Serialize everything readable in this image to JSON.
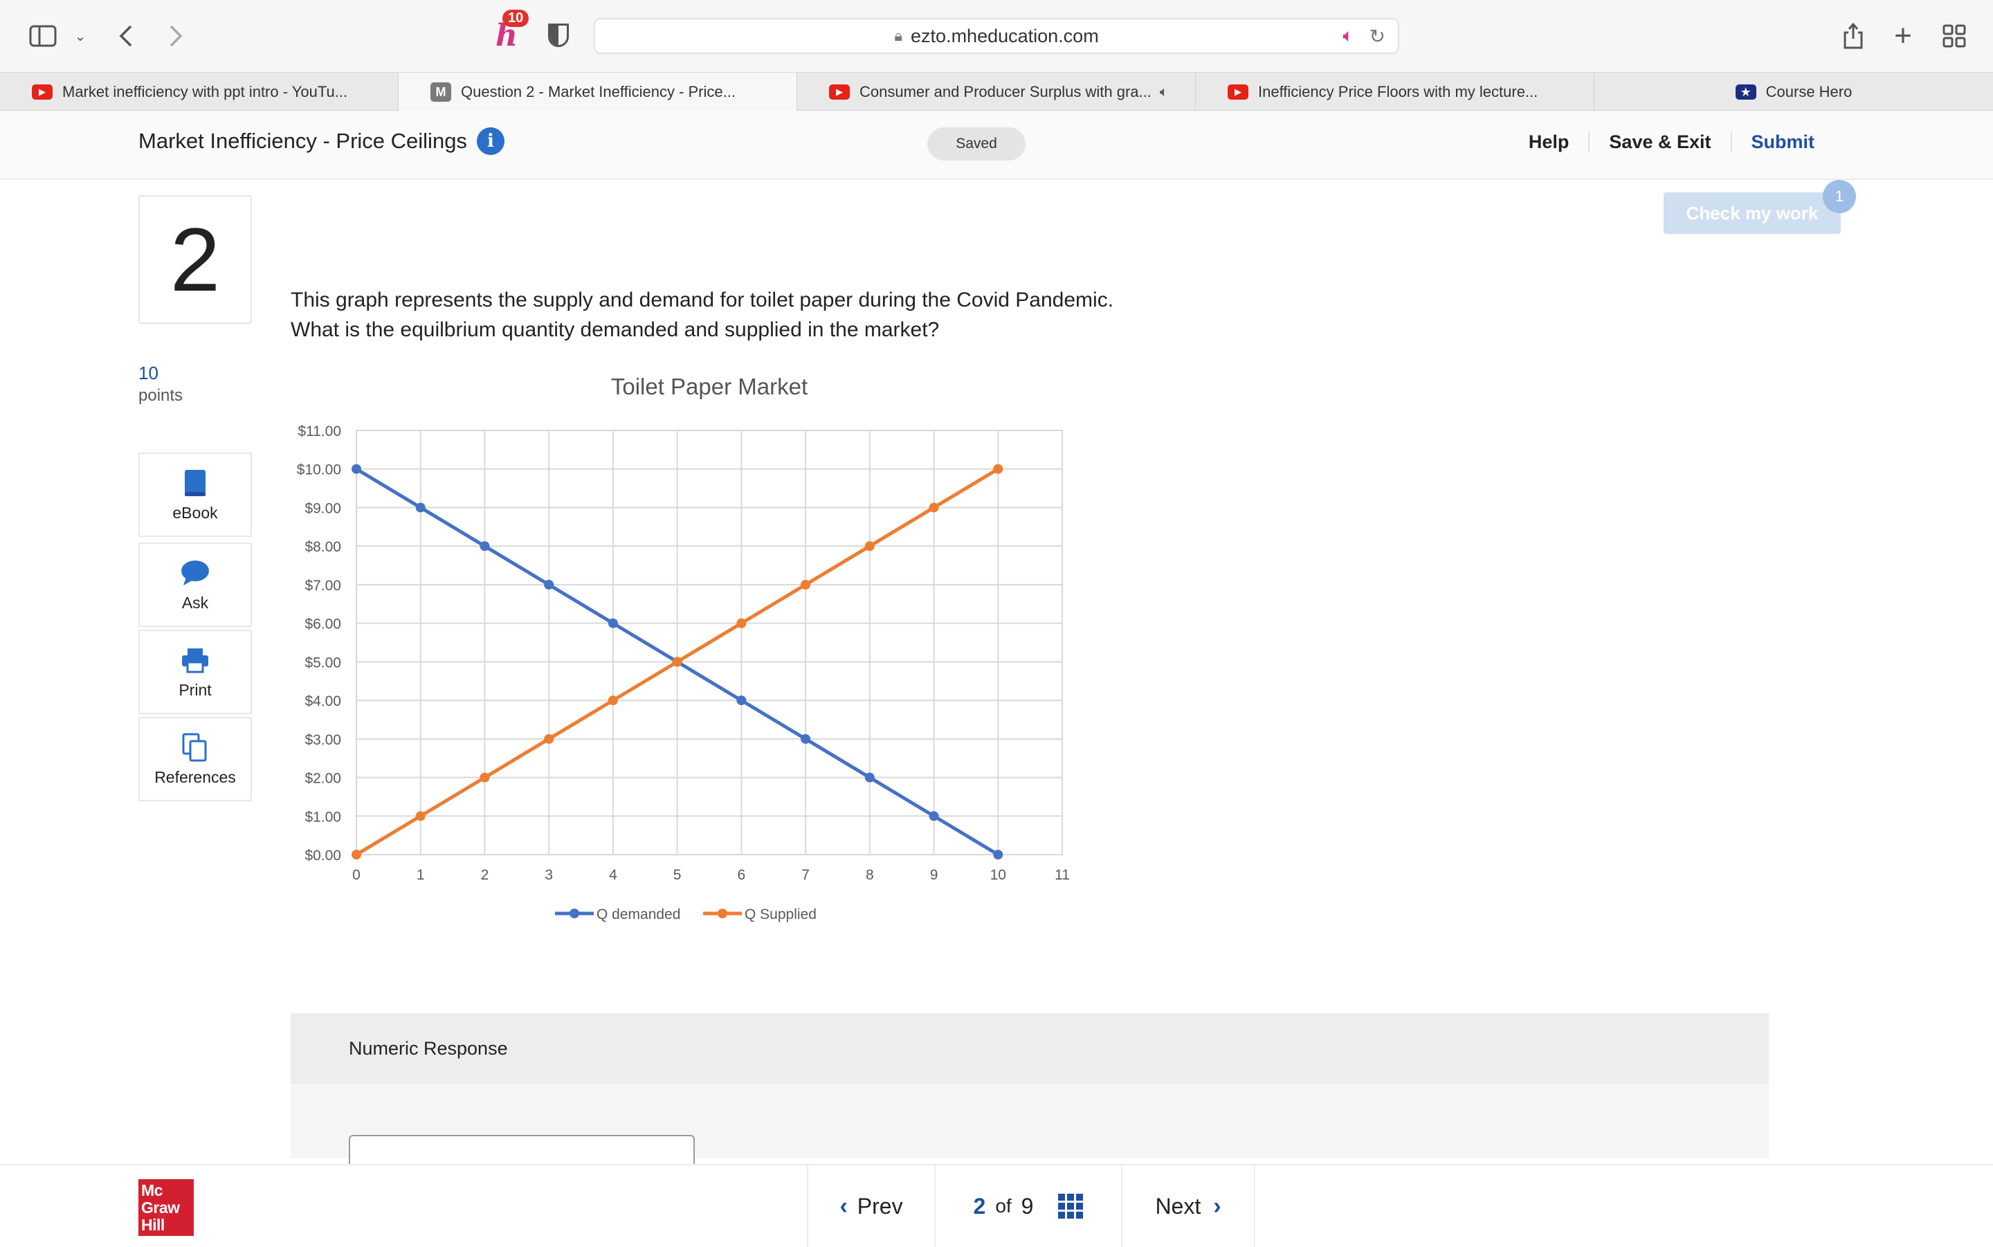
{
  "browser": {
    "url": "ezto.mheducation.com",
    "honey_badge": "10",
    "tabs": [
      {
        "label": "Market inefficiency with ppt intro - YouTu...",
        "favicon": "youtube-icon",
        "active": false
      },
      {
        "label": "Question 2 - Market Inefficiency - Price...",
        "favicon": "m-icon",
        "active": true
      },
      {
        "label": "Consumer and Producer Surplus with gra...",
        "favicon": "youtube-icon",
        "active": false,
        "audio": true
      },
      {
        "label": "Inefficiency Price Floors with my lecture...",
        "favicon": "youtube-icon",
        "active": false
      },
      {
        "label": "Course Hero",
        "favicon": "coursehero-icon",
        "active": false
      }
    ]
  },
  "header": {
    "title": "Market Inefficiency - Price Ceilings",
    "status": "Saved",
    "help": "Help",
    "save_exit": "Save & Exit",
    "submit": "Submit"
  },
  "check": {
    "label": "Check my work",
    "badge": "1"
  },
  "question": {
    "number": "2",
    "points": "10",
    "points_label": "points",
    "text_line1": "This graph represents the supply and demand for toilet paper during the Covid Pandemic.",
    "text_line2": "What is the equilbrium quantity demanded and supplied in the market?"
  },
  "tools": [
    {
      "label": "eBook",
      "icon": "book-icon"
    },
    {
      "label": "Ask",
      "icon": "chat-bubble-icon"
    },
    {
      "label": "Print",
      "icon": "printer-icon"
    },
    {
      "label": "References",
      "icon": "documents-icon"
    }
  ],
  "chart_data": {
    "type": "line",
    "title": "Toilet Paper Market",
    "x": [
      0,
      1,
      2,
      3,
      4,
      5,
      6,
      7,
      8,
      9,
      10
    ],
    "x_ticks": [
      "0",
      "1",
      "2",
      "3",
      "4",
      "5",
      "6",
      "7",
      "8",
      "9",
      "10",
      "11"
    ],
    "y_ticks": [
      "$0.00",
      "$1.00",
      "$2.00",
      "$3.00",
      "$4.00",
      "$5.00",
      "$6.00",
      "$7.00",
      "$8.00",
      "$9.00",
      "$10.00",
      "$11.00"
    ],
    "xlim": [
      0,
      11
    ],
    "ylim": [
      0,
      11
    ],
    "grid": true,
    "legend_position": "bottom",
    "series": [
      {
        "name": "Q demanded",
        "color": "#4472c4",
        "values": [
          10,
          9,
          8,
          7,
          6,
          5,
          4,
          3,
          2,
          1,
          0
        ]
      },
      {
        "name": "Q Supplied",
        "color": "#ed7d31",
        "values": [
          0,
          1,
          2,
          3,
          4,
          5,
          6,
          7,
          8,
          9,
          10
        ]
      }
    ]
  },
  "response": {
    "heading": "Numeric Response"
  },
  "footer": {
    "logo_lines": [
      "Mc",
      "Graw",
      "Hill"
    ],
    "prev": "Prev",
    "current": "2",
    "of": "of",
    "total": "9",
    "next": "Next"
  }
}
